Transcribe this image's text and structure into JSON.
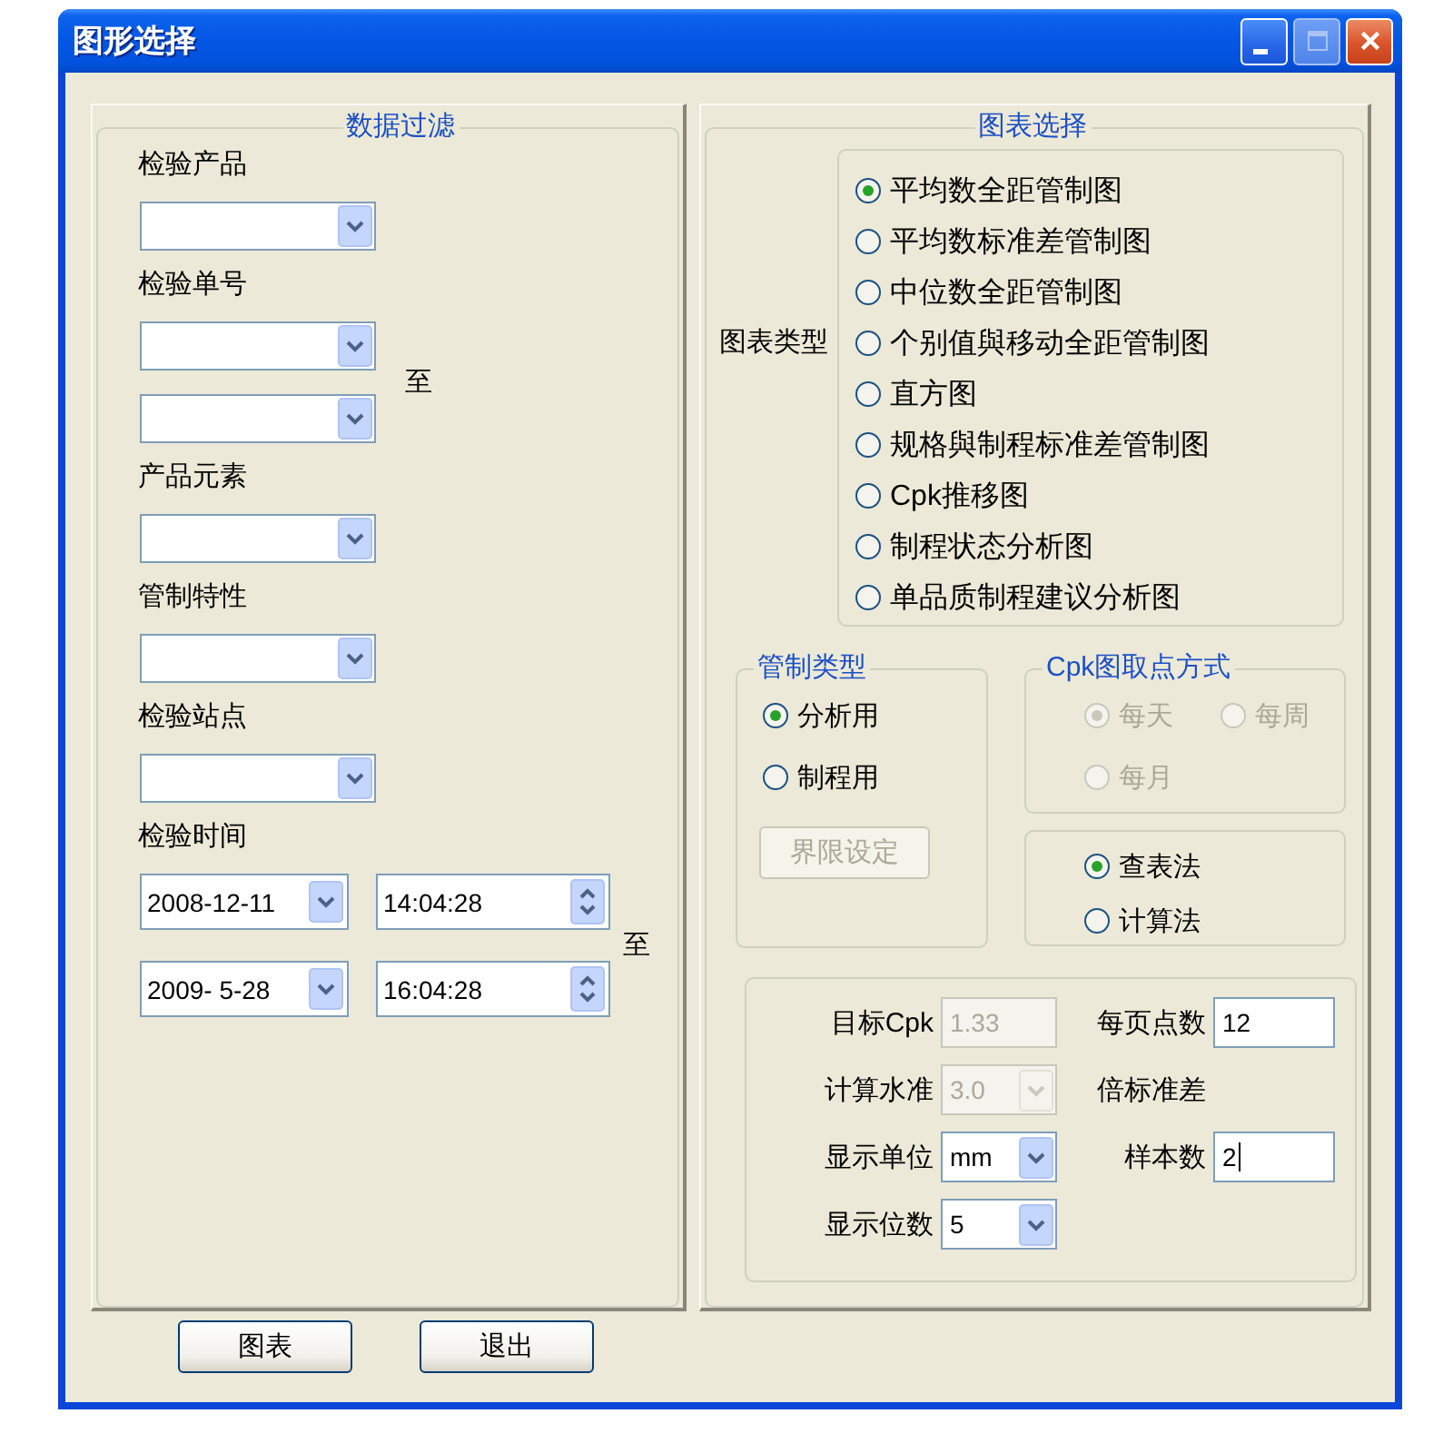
{
  "window": {
    "title": "图形选择",
    "controls": [
      {
        "kind": "minimize",
        "disabled": false
      },
      {
        "kind": "maximize",
        "disabled": true
      },
      {
        "kind": "close",
        "disabled": false
      }
    ]
  },
  "data_filter": {
    "title": "数据过滤",
    "fields": [
      {
        "kind": "combo",
        "label": "检验产品"
      },
      {
        "kind": "combo_range",
        "label": "检验单号",
        "separator": "至"
      },
      {
        "kind": "combo",
        "label": "产品元素"
      },
      {
        "kind": "combo",
        "label": "管制特性"
      },
      {
        "kind": "combo",
        "label": "检验站点"
      },
      {
        "kind": "datetime_range",
        "label": "检验时间",
        "separator": "至",
        "from": {
          "date": "2008-12-11",
          "time": "14:04:28"
        },
        "to": {
          "date": "2009- 5-28",
          "time": "16:04:28"
        }
      }
    ]
  },
  "chart_selection": {
    "title": "图表选择",
    "type_label": "图表类型",
    "chart_types": [
      {
        "label": "平均数全距管制图",
        "selected": true
      },
      {
        "label": "平均数标准差管制图",
        "selected": false
      },
      {
        "label": "中位数全距管制图",
        "selected": false
      },
      {
        "label": "个别值與移动全距管制图",
        "selected": false
      },
      {
        "label": "直方图",
        "selected": false
      },
      {
        "label": "规格與制程标准差管制图",
        "selected": false
      },
      {
        "label": "Cpk推移图",
        "selected": false
      },
      {
        "label": "制程状态分析图",
        "selected": false
      },
      {
        "label": "单品质制程建议分析图",
        "selected": false
      }
    ]
  },
  "control_type": {
    "title": "管制类型",
    "options": [
      {
        "label": "分析用",
        "selected": true
      },
      {
        "label": "制程用",
        "selected": false
      }
    ],
    "limit_button": {
      "label": "界限设定",
      "disabled": true
    }
  },
  "cpk_sampling": {
    "title": "Cpk图取点方式",
    "options": [
      {
        "label": "每天",
        "selected": true,
        "disabled": true
      },
      {
        "label": "每周",
        "selected": false,
        "disabled": true
      },
      {
        "label": "每月",
        "selected": false,
        "disabled": true
      }
    ]
  },
  "calc_method": {
    "options": [
      {
        "label": "查表法",
        "selected": true
      },
      {
        "label": "计算法",
        "selected": false
      }
    ]
  },
  "parameters": {
    "rows": [
      [
        {
          "kind": "text",
          "label": "目标Cpk",
          "value": "1.33",
          "disabled": true,
          "focused": false
        },
        {
          "kind": "text",
          "label": "每页点数",
          "value": "12",
          "disabled": false,
          "focused": false
        }
      ],
      [
        {
          "kind": "combo",
          "label": "计算水准",
          "value": "3.0",
          "disabled": true
        },
        {
          "kind": "note",
          "label": "倍标准差"
        }
      ],
      [
        {
          "kind": "combo",
          "label": "显示单位",
          "value": "mm",
          "disabled": false
        },
        {
          "kind": "text",
          "label": "样本数",
          "value": "2",
          "disabled": false,
          "focused": true
        }
      ],
      [
        {
          "kind": "combo",
          "label": "显示位数",
          "value": "5",
          "disabled": false
        }
      ]
    ]
  },
  "buttons": [
    {
      "label": "图表"
    },
    {
      "label": "退出"
    }
  ]
}
